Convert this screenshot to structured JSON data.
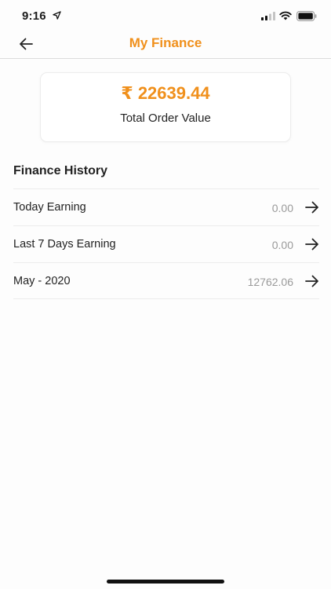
{
  "status_bar": {
    "time": "9:16",
    "icons": [
      "location-arrow-icon",
      "cellular-signal-icon",
      "wifi-icon",
      "battery-icon"
    ]
  },
  "header": {
    "title": "My Finance",
    "back_icon": "arrow-left-icon",
    "accent_color": "#f0901c"
  },
  "summary": {
    "total_amount": "₹ 22639.44",
    "total_label": "Total Order Value"
  },
  "history": {
    "heading": "Finance History",
    "rows": [
      {
        "label": "Today Earning",
        "value": "0.00",
        "icon": "arrow-right-icon"
      },
      {
        "label": "Last 7 Days Earning",
        "value": "0.00",
        "icon": "arrow-right-icon"
      },
      {
        "label": "May - 2020",
        "value": "12762.06",
        "icon": "arrow-right-icon"
      }
    ]
  }
}
